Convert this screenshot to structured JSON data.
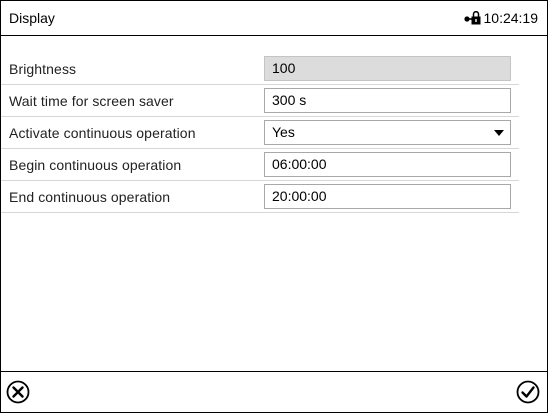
{
  "header": {
    "title": "Display",
    "time": "10:24:19",
    "status_icon": "lock-icon"
  },
  "settings": [
    {
      "label": "Brightness",
      "value": "100",
      "editable": false
    },
    {
      "label": "Wait time for screen saver",
      "value": "300 s",
      "editable": true
    },
    {
      "label": "Activate continuous operation",
      "value": "Yes",
      "editable": true,
      "type": "dropdown"
    },
    {
      "label": "Begin continuous operation",
      "value": "06:00:00",
      "editable": true
    },
    {
      "label": "End continuous operation",
      "value": "20:00:00",
      "editable": true
    }
  ],
  "footer": {
    "cancel_icon": "cancel-circle-x-icon",
    "confirm_icon": "confirm-circle-check-icon"
  }
}
